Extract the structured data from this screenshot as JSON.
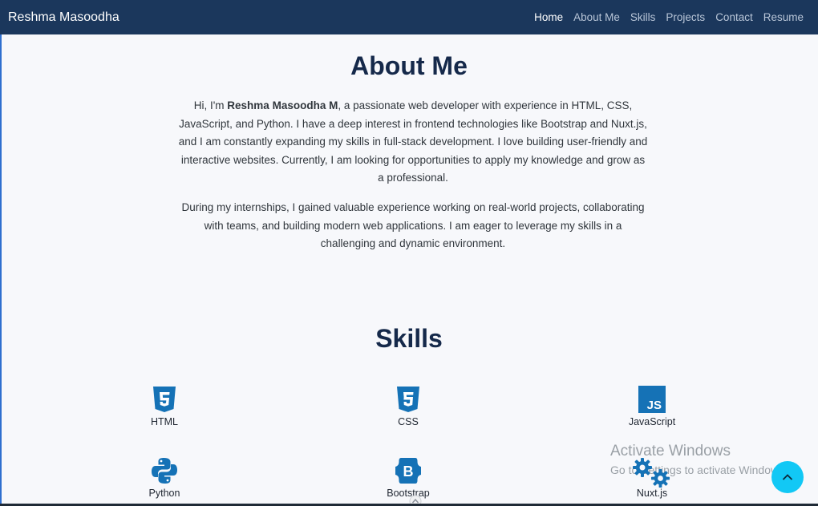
{
  "nav": {
    "brand": "Reshma Masoodha",
    "links": [
      "Home",
      "About Me",
      "Skills",
      "Projects",
      "Contact",
      "Resume"
    ]
  },
  "about": {
    "title": "About Me",
    "p1_prefix": "Hi, I'm ",
    "p1_name": "Reshma Masoodha M",
    "p1_rest": ", a passionate web developer with experience in HTML, CSS, JavaScript, and Python. I have a deep interest in frontend technologies like Bootstrap and Nuxt.js, and I am constantly expanding my skills in full-stack development. I love building user-friendly and interactive websites. Currently, I am looking for opportunities to apply my knowledge and grow as a professional.",
    "p2": "During my internships, I gained valuable experience working on real-world projects, collaborating with teams, and building modern web applications. I am eager to leverage my skills in a challenging and dynamic environment."
  },
  "skills": {
    "title": "Skills",
    "items": [
      {
        "label": "HTML",
        "icon": "html5-icon"
      },
      {
        "label": "CSS",
        "icon": "css3-icon"
      },
      {
        "label": "JavaScript",
        "icon": "javascript-icon"
      },
      {
        "label": "Python",
        "icon": "python-icon"
      },
      {
        "label": "Bootstrap",
        "icon": "bootstrap-icon"
      },
      {
        "label": "Nuxt.js",
        "icon": "nuxt-icon"
      }
    ]
  },
  "watermark": {
    "title": "Activate Windows",
    "subtitle": "Go to Settings to activate Windows."
  },
  "colors": {
    "navbar": "#1b375c",
    "accent_blue": "#1572b6",
    "scroll_button": "#12c8f5"
  }
}
